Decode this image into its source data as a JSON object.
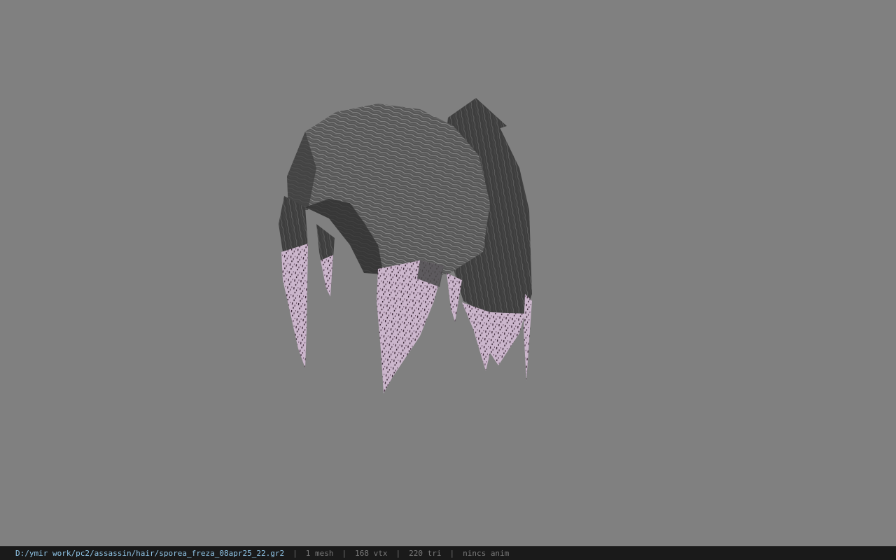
{
  "viewport": {
    "background_color": "#808080",
    "model_subject": "hair-mesh"
  },
  "status": {
    "file_path": "D:/ymir work/pc2/assassin/hair/sporea_freza_08apr25_22.gr2",
    "separator": "|",
    "mesh_count": "1 mesh",
    "vertex_count": "168 vtx",
    "triangle_count": "220 tri",
    "anim_state": "nincs anim"
  },
  "colors": {
    "hair_dark": "#3c3c3c",
    "hair_mid": "#5a5a5a",
    "hair_light": "#7b7b7b",
    "tip_lilac": "#cdb9cf",
    "tip_speckle": "#3a2636",
    "path_text": "#8fc4e6",
    "stat_text": "#7a7a7a",
    "bar_bg": "#1a1a1a"
  }
}
